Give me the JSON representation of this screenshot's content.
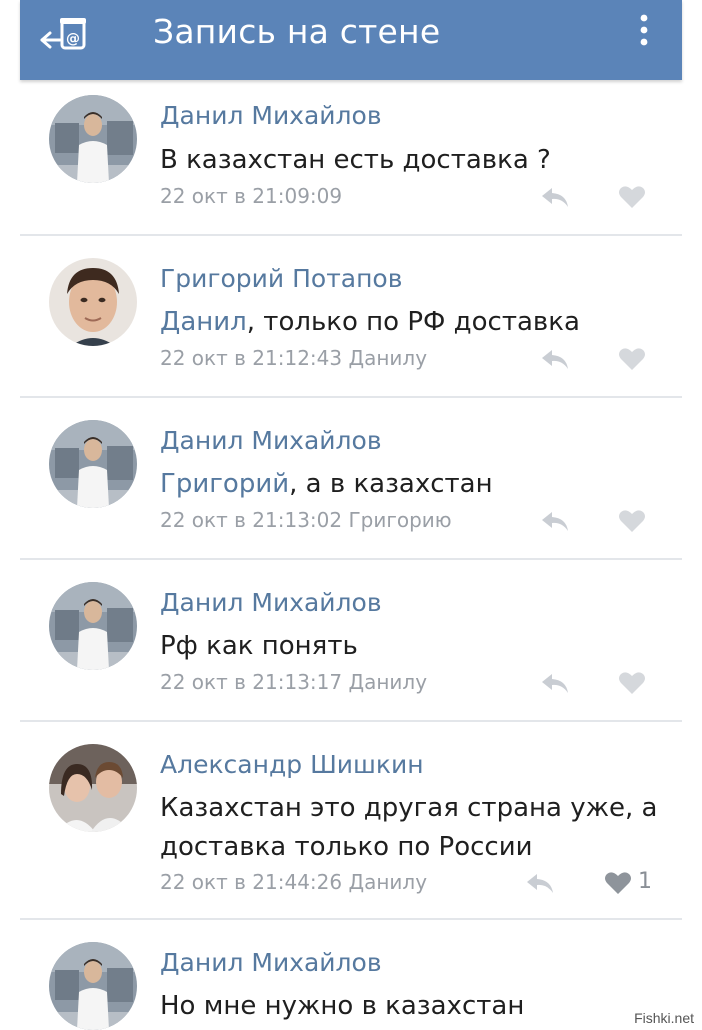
{
  "header": {
    "title": "Запись на стене",
    "back_icon": "back-arrow-icon",
    "menu_icon": "more-vertical-icon",
    "bg_color": "#5b84b8"
  },
  "comments": [
    {
      "author": "Данил Михайлов",
      "mention": "",
      "text": "В казахстан есть доставка ?",
      "time": "22 окт в 21:09:09",
      "reply_to": "",
      "likes": ""
    },
    {
      "author": "Григорий Потапов",
      "mention": "Данил",
      "text": ", только по РФ доставка",
      "time": "22 окт в 21:12:43",
      "reply_to": "Данилу",
      "likes": ""
    },
    {
      "author": "Данил Михайлов",
      "mention": "Григорий",
      "text": ", а в казахстан",
      "time": "22 окт в 21:13:02",
      "reply_to": "Григорию",
      "likes": ""
    },
    {
      "author": "Данил Михайлов",
      "mention": "",
      "text": "Рф как понять",
      "time": "22 окт в 21:13:17",
      "reply_to": "Данилу",
      "likes": ""
    },
    {
      "author": "Александр Шишкин",
      "mention": "",
      "text": "Казахстан это другая страна уже, а доставка только по России",
      "time": "22 окт в 21:44:26",
      "reply_to": "Данилу",
      "likes": "1"
    },
    {
      "author": "Данил Михайлов",
      "mention": "",
      "text": "Но мне нужно в казахстан",
      "time": "",
      "reply_to": "",
      "likes": ""
    }
  ],
  "watermark": "Fishki.net",
  "colors": {
    "link": "#56799f",
    "meta": "#9a9fa6",
    "divider": "#e3e6ea",
    "icon": "#c9cdd3"
  }
}
